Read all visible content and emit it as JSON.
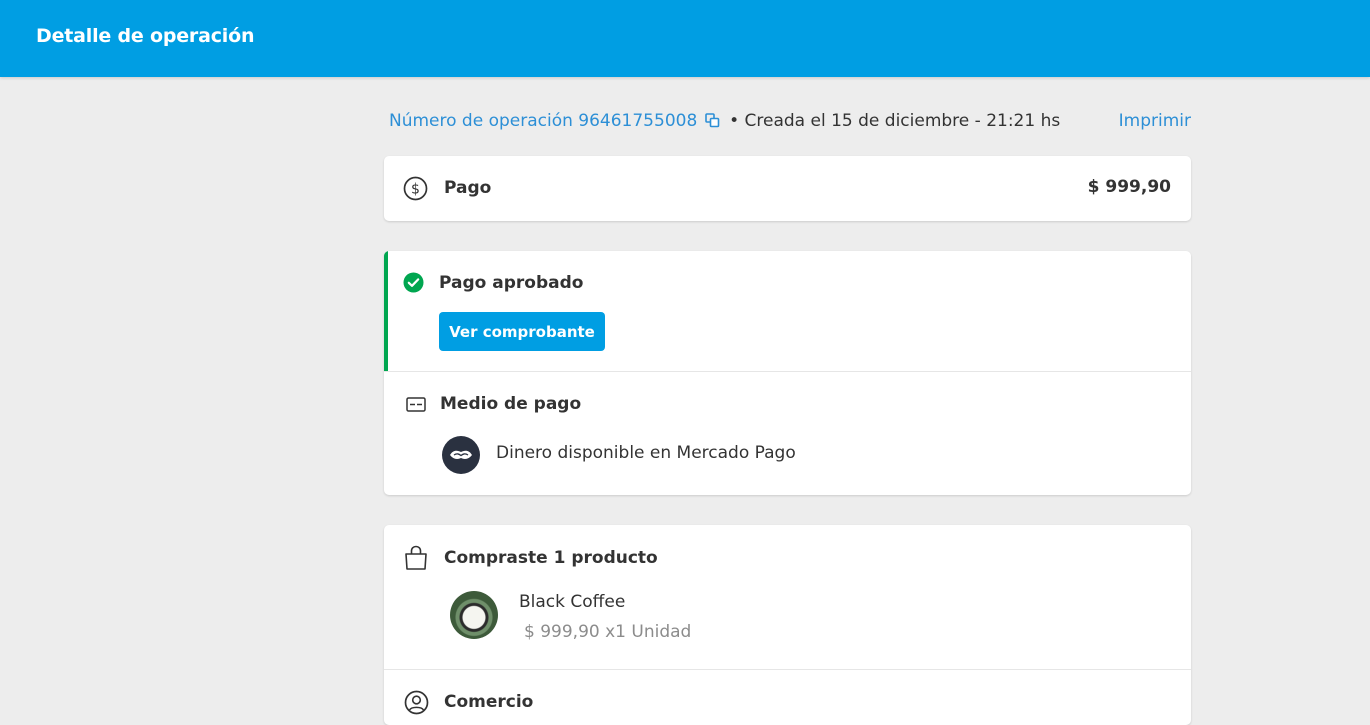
{
  "header": {
    "title": "Detalle de operación"
  },
  "meta": {
    "operation_label": "Número de operación 96461755008",
    "created": "Creada el 15 de diciembre - 21:21 hs",
    "separator": "•",
    "print_label": "Imprimir"
  },
  "payment_summary": {
    "label": "Pago",
    "amount": "$ 999,90"
  },
  "status": {
    "label": "Pago aprobado",
    "button_label": "Ver comprobante",
    "color": "#00a650"
  },
  "payment_method": {
    "title": "Medio de pago",
    "method": "Dinero disponible en Mercado Pago"
  },
  "purchase": {
    "title": "Compraste 1 producto",
    "product_name": "Black Coffee",
    "product_detail": "$ 999,90 x1 Unidad"
  },
  "merchant": {
    "title": "Comercio"
  },
  "colors": {
    "brand": "#009ee3",
    "link": "#2d8fd6",
    "success": "#00a650",
    "background": "#ededed"
  }
}
